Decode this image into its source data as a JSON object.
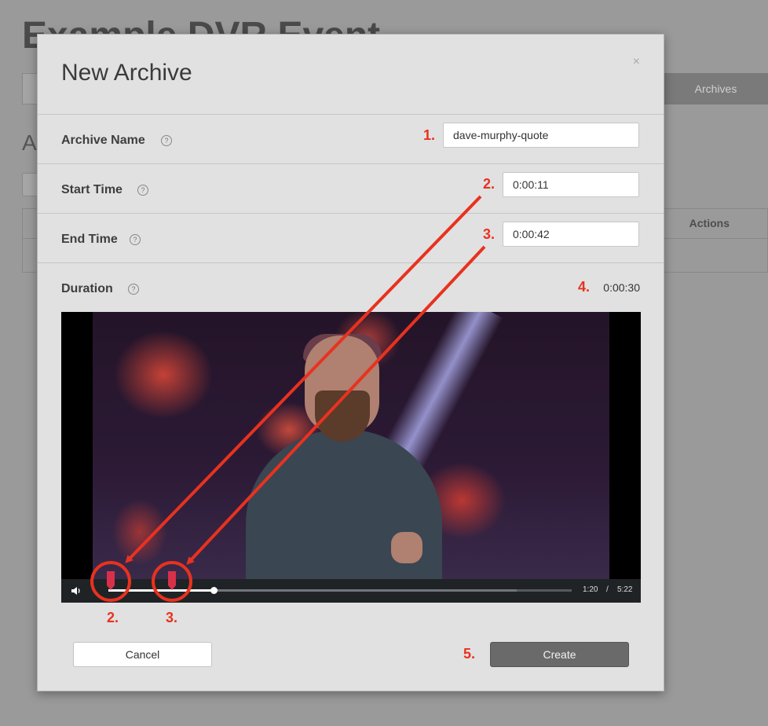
{
  "background": {
    "title": "Example DVR Event",
    "active_tab": "Archives",
    "heading": "A",
    "table_actions_header": "Actions"
  },
  "modal": {
    "title": "New Archive",
    "close_label": "×",
    "fields": {
      "archive_name": {
        "label": "Archive Name",
        "value": "dave-murphy-quote"
      },
      "start_time": {
        "label": "Start Time",
        "value": "0:00:11"
      },
      "end_time": {
        "label": "End Time",
        "value": "0:00:42"
      },
      "duration": {
        "label": "Duration",
        "value": "0:00:30"
      }
    },
    "help_icon_glyph": "?",
    "video": {
      "current_time": "1:20",
      "separator": "/",
      "total_time": "5:22",
      "progress_fraction": 0.25,
      "buffered_fraction": 0.88
    },
    "buttons": {
      "cancel": "Cancel",
      "create": "Create"
    }
  },
  "annotations": {
    "n1": "1.",
    "n2": "2.",
    "n3": "3.",
    "n4": "4.",
    "n5": "5.",
    "marker_2": "2.",
    "marker_3": "3."
  },
  "colors": {
    "annotation_red": "#e8321f",
    "marker_red": "#d9304a",
    "create_button": "#6a6a6a"
  },
  "icons": [
    "help-icon",
    "volume-icon",
    "close-icon",
    "marker-flag-icon"
  ]
}
